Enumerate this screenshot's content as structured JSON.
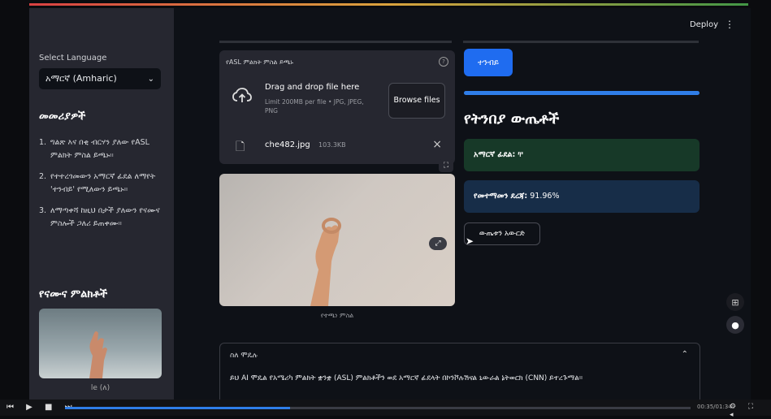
{
  "header": {
    "deploy_label": "Deploy",
    "menu_icon": "kebab-menu-icon"
  },
  "sidebar": {
    "language_label": "Select Language",
    "language_value": "አማርኛ (Amharic)",
    "instructions_title": "መመሪያዎች",
    "instructions": [
      {
        "num": "1.",
        "text": "ግልጽ እና በቂ ብርሃን ያለው የASL ምልክት ምስል ይጫኑ።"
      },
      {
        "num": "2.",
        "text": "የተተረጎመውን አማርኛ ፊደል ለማየት 'ተንብይ' የሚለውን ይጫኑ።"
      },
      {
        "num": "3.",
        "text": "ለማጣቀሻ ከዚህ በታች ያለውን የናሙና ምስሎች ጋለሪ ይጠቀሙ።"
      }
    ],
    "samples_title": "የናሙና ምልክቶች",
    "sample_caption": "le (ለ)"
  },
  "uploader": {
    "title": "የASL ምልክት ምስል ይጫኑ",
    "help_icon": "?",
    "drop_title": "Drag and drop file here",
    "drop_limit": "Limit 200MB per file • JPG, JPEG, PNG",
    "browse_label": "Browse files",
    "file_name": "che482.jpg",
    "file_size": "103.3KB",
    "remove_icon": "×"
  },
  "image": {
    "caption": "የተጫነ ምስል"
  },
  "results": {
    "predict_label": "ተንብይ",
    "progress": 1.0,
    "heading": "የትንበያ ውጤቶች",
    "letter_label": "አማርኛ ፊደል:",
    "letter_value": "ቸ",
    "confidence_label": "የመተማመን ደረጃ:",
    "confidence_value": "91.96%",
    "download_label": "ውጤቱን አውርድ"
  },
  "about": {
    "title": "ስለ ሞዴሉ",
    "text": "ይህ AI ሞዴል የአሜሪካ ምልክት ቋንቋ (ASL) ምልክቶችን ወደ አማርኛ ፊደላት በኮንቮሉሽናል ኒውራል ኔትወርክ (CNN) ይተረጉማል።"
  },
  "video": {
    "controls": "⏮ ▶ ■ ⏭",
    "progress": 0.36,
    "time": "00:35/01:34"
  },
  "colors": {
    "accent_blue": "#1f6cf0",
    "success_bg": "#173928",
    "info_bg": "#172d48"
  }
}
